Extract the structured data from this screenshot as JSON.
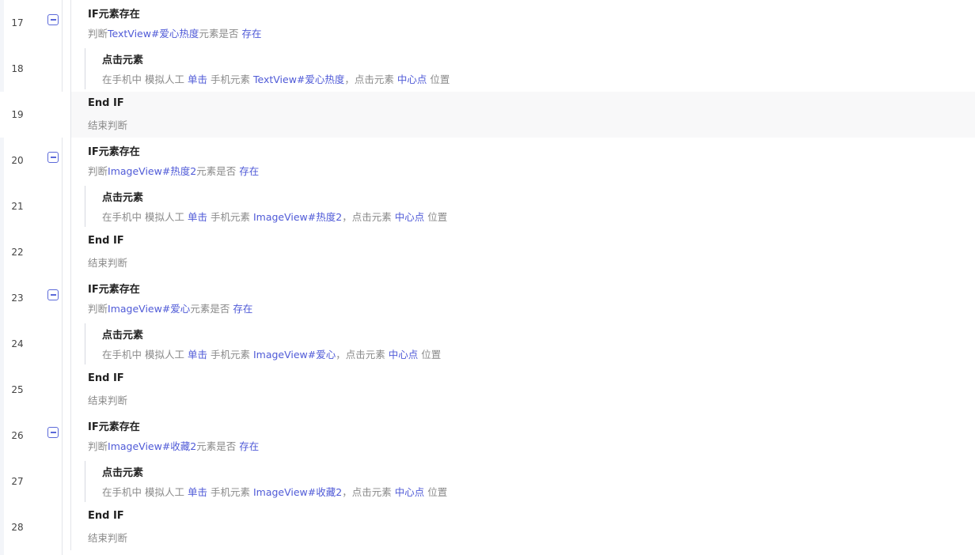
{
  "colors": {
    "accent": "#4f5ad7",
    "title": "#222222",
    "muted": "#8a8a8a"
  },
  "rows": [
    {
      "num": "17",
      "title": "IF元素存在",
      "desc": [
        "判断",
        "TextView#爱心热度",
        "元素是否",
        "存在"
      ]
    },
    {
      "num": "18",
      "title": "点击元素",
      "desc": [
        "在手机中 模拟人工",
        "单击",
        "手机元素",
        "TextView#爱心热度",
        "，点击元素",
        "中心点",
        "位置"
      ]
    },
    {
      "num": "19",
      "title": "End IF",
      "desc": [
        "结束判断"
      ]
    },
    {
      "num": "20",
      "title": "IF元素存在",
      "desc": [
        "判断",
        "ImageView#热度2",
        "元素是否",
        "存在"
      ]
    },
    {
      "num": "21",
      "title": "点击元素",
      "desc": [
        "在手机中 模拟人工",
        "单击",
        "手机元素",
        "ImageView#热度2",
        "，点击元素",
        "中心点",
        "位置"
      ]
    },
    {
      "num": "22",
      "title": "End IF",
      "desc": [
        "结束判断"
      ]
    },
    {
      "num": "23",
      "title": "IF元素存在",
      "desc": [
        "判断",
        "ImageView#爱心",
        "元素是否",
        "存在"
      ]
    },
    {
      "num": "24",
      "title": "点击元素",
      "desc": [
        "在手机中 模拟人工",
        "单击",
        "手机元素",
        "ImageView#爱心",
        "，点击元素",
        "中心点",
        "位置"
      ]
    },
    {
      "num": "25",
      "title": "End IF",
      "desc": [
        "结束判断"
      ]
    },
    {
      "num": "26",
      "title": "IF元素存在",
      "desc": [
        "判断",
        "ImageView#收藏2",
        "元素是否",
        "存在"
      ]
    },
    {
      "num": "27",
      "title": "点击元素",
      "desc": [
        "在手机中 模拟人工",
        "单击",
        "手机元素",
        "ImageView#收藏2",
        "，点击元素",
        "中心点",
        "位置"
      ]
    },
    {
      "num": "28",
      "title": "End IF",
      "desc": [
        "结束判断"
      ]
    }
  ]
}
